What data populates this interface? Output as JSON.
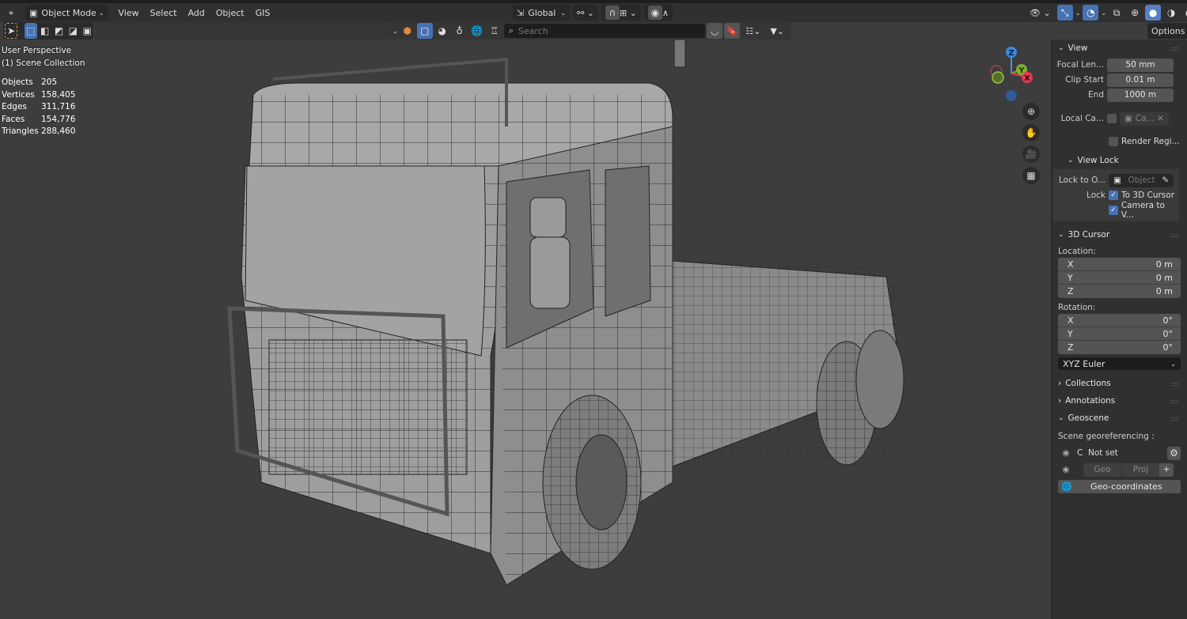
{
  "header": {
    "mode": "Object Mode",
    "menus": [
      "View",
      "Select",
      "Add",
      "Object",
      "GIS"
    ],
    "transform_orientation": "Global",
    "options_label": "Options",
    "search_placeholder": "Search"
  },
  "overlay": {
    "view_name": "User Perspective",
    "collection": "(1) Scene Collection",
    "stats": [
      {
        "label": "Objects",
        "value": "205"
      },
      {
        "label": "Vertices",
        "value": "158,405"
      },
      {
        "label": "Edges",
        "value": "311,716"
      },
      {
        "label": "Faces",
        "value": "154,776"
      },
      {
        "label": "Triangles",
        "value": "288,460"
      }
    ]
  },
  "gizmo": {
    "z": "Z",
    "y": "Y",
    "x": "X"
  },
  "sidebar": {
    "view": {
      "title": "View",
      "focal_label": "Focal Len...",
      "focal_value": "50 mm",
      "clip_start_label": "Clip Start",
      "clip_start_value": "0.01 m",
      "end_label": "End",
      "end_value": "1000 m",
      "local_camera_label": "Local Ca...",
      "local_camera_value": "Ca...",
      "render_region_label": "Render Regi..."
    },
    "view_lock": {
      "title": "View Lock",
      "lock_to_label": "Lock to O...",
      "lock_to_placeholder": "Object",
      "lock_label": "Lock",
      "to_3d_cursor": "To 3D Cursor",
      "camera_to_view": "Camera to V..."
    },
    "cursor": {
      "title": "3D Cursor",
      "location_label": "Location:",
      "location": [
        {
          "axis": "X",
          "value": "0 m"
        },
        {
          "axis": "Y",
          "value": "0 m"
        },
        {
          "axis": "Z",
          "value": "0 m"
        }
      ],
      "rotation_label": "Rotation:",
      "rotation": [
        {
          "axis": "X",
          "value": "0°"
        },
        {
          "axis": "Y",
          "value": "0°"
        },
        {
          "axis": "Z",
          "value": "0°"
        }
      ],
      "rotation_mode": "XYZ Euler"
    },
    "collections": "Collections",
    "annotations": "Annotations",
    "geoscene": {
      "title": "Geoscene",
      "georef_label": "Scene georeferencing :",
      "crs_prefix": "C",
      "crs_value": "Not set",
      "geo": "Geo",
      "proj": "Proj",
      "geo_coordinates": "Geo-coordinates"
    }
  }
}
